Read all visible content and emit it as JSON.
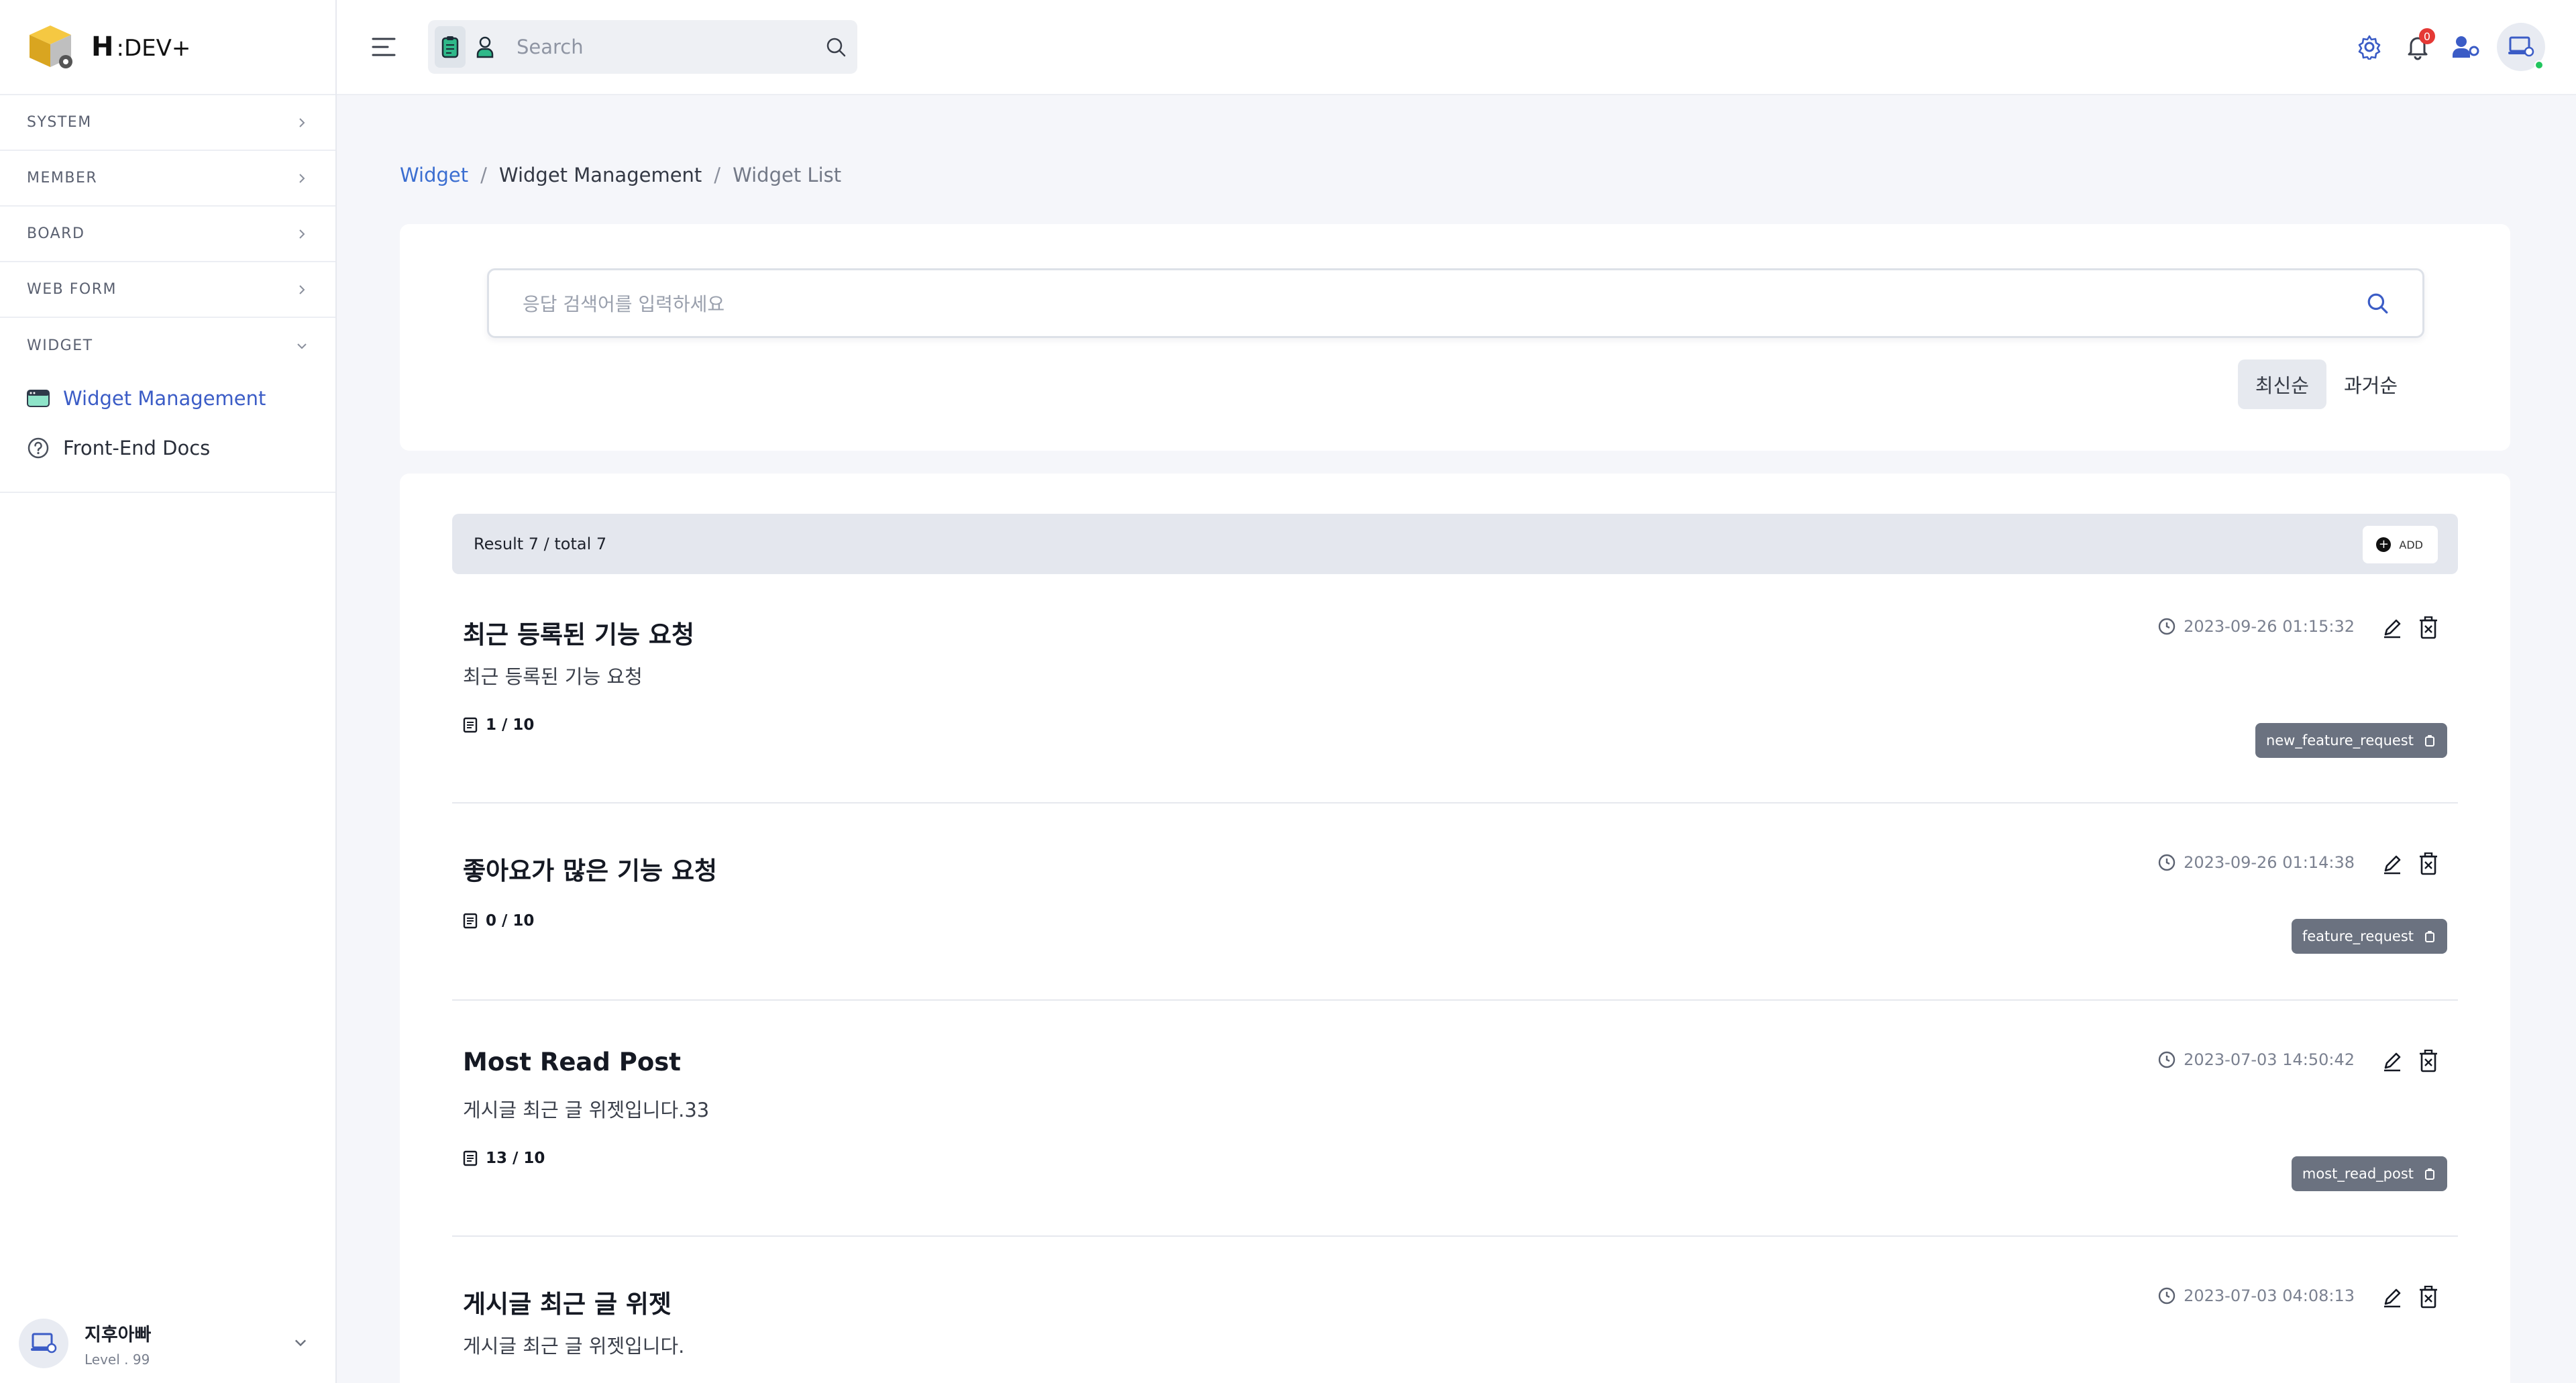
{
  "brand": {
    "initial": "H",
    "suffix": ":DEV+"
  },
  "sidebar": {
    "sections": [
      {
        "label": "SYSTEM"
      },
      {
        "label": "MEMBER"
      },
      {
        "label": "BOARD"
      },
      {
        "label": "WEB FORM"
      },
      {
        "label": "WIDGET"
      }
    ],
    "widget_items": [
      {
        "label": "Widget Management",
        "icon": "widget-icon"
      },
      {
        "label": "Front-End Docs",
        "icon": "help-circle-icon"
      }
    ],
    "user": {
      "name": "지후아빠",
      "level": "Level . 99"
    }
  },
  "topbar": {
    "search_placeholder": "Search",
    "notification_count": "0"
  },
  "breadcrumb": {
    "items": [
      "Widget",
      "Widget Management",
      "Widget List"
    ],
    "separator": "/"
  },
  "search_panel": {
    "placeholder": "응답 검색어를 입력하세요",
    "sort_options": [
      "최신순",
      "과거순"
    ]
  },
  "results": {
    "summary": "Result 7 / total 7",
    "add_label": "ADD"
  },
  "widgets": [
    {
      "title": "최근 등록된 기능 요청",
      "description": "최근 등록된 기능 요청",
      "count": "1 / 10",
      "date": "2023-09-26 01:15:32",
      "tag": "new_feature_request"
    },
    {
      "title": "좋아요가 많은 기능 요청",
      "description": "",
      "count": "0 / 10",
      "date": "2023-09-26 01:14:38",
      "tag": "feature_request"
    },
    {
      "title": "Most Read Post",
      "description": "게시글 최근 글 위젯입니다.33",
      "count": "13 / 10",
      "date": "2023-07-03 14:50:42",
      "tag": "most_read_post"
    },
    {
      "title": "게시글 최근 글 위젯",
      "description": "게시글 최근 글 위젯입니다.",
      "count": "",
      "date": "2023-07-03 04:08:13",
      "tag": ""
    }
  ],
  "colors": {
    "accent": "#3b5cc6",
    "link": "#3b6ed1",
    "tag_bg": "#6b7280",
    "badge": "#e53935",
    "online": "#22c55e"
  }
}
